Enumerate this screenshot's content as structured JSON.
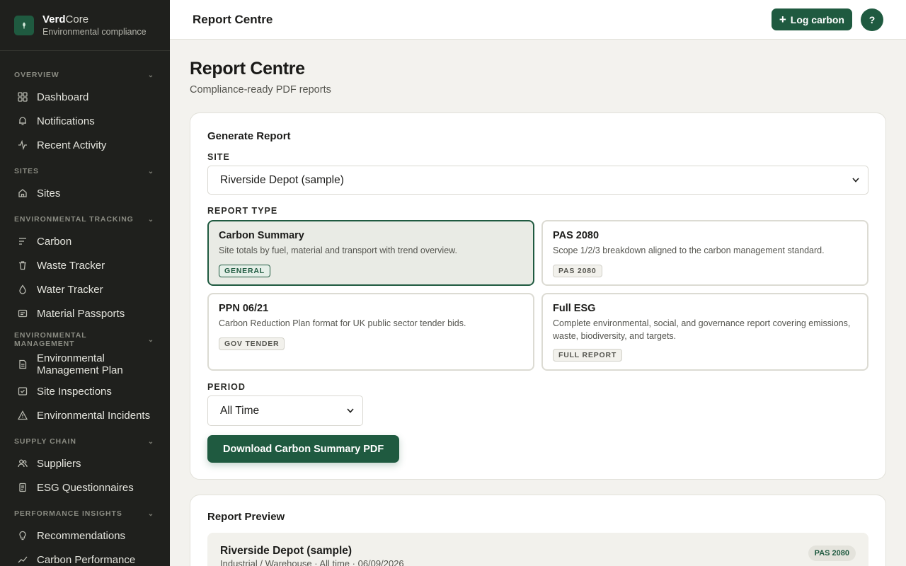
{
  "brand": {
    "name_bold": "Verd",
    "name_rest": "Core",
    "subtitle": "Environmental compliance",
    "logo_icon": "leaf-icon"
  },
  "sidebar": {
    "sections": [
      {
        "title": "OVERVIEW",
        "items": [
          {
            "label": "Dashboard",
            "icon": "grid-icon"
          },
          {
            "label": "Notifications",
            "icon": "bell-icon"
          },
          {
            "label": "Recent Activity",
            "icon": "activity-icon"
          }
        ]
      },
      {
        "title": "SITES",
        "items": [
          {
            "label": "Sites",
            "icon": "home-icon"
          }
        ]
      },
      {
        "title": "ENVIRONMENTAL TRACKING",
        "items": [
          {
            "label": "Carbon",
            "icon": "lines-icon"
          },
          {
            "label": "Waste Tracker",
            "icon": "bin-icon"
          },
          {
            "label": "Water Tracker",
            "icon": "droplet-icon"
          },
          {
            "label": "Material Passports",
            "icon": "id-card-icon"
          }
        ]
      },
      {
        "title": "ENVIRONMENTAL MANAGEMENT",
        "items": [
          {
            "label": "Environmental Management Plan",
            "icon": "document-icon"
          },
          {
            "label": "Site Inspections",
            "icon": "check-square-icon"
          },
          {
            "label": "Environmental Incidents",
            "icon": "warning-icon"
          }
        ]
      },
      {
        "title": "SUPPLY CHAIN",
        "items": [
          {
            "label": "Suppliers",
            "icon": "users-icon"
          },
          {
            "label": "ESG Questionnaires",
            "icon": "clipboard-icon"
          }
        ]
      },
      {
        "title": "PERFORMANCE INSIGHTS",
        "items": [
          {
            "label": "Recommendations",
            "icon": "lightbulb-icon"
          },
          {
            "label": "Carbon Performance",
            "icon": "trend-icon"
          }
        ]
      }
    ]
  },
  "topbar": {
    "title": "Report Centre",
    "log_label": "Log carbon",
    "help_label": "?"
  },
  "page": {
    "title": "Report Centre",
    "subtitle": "Compliance-ready PDF reports"
  },
  "generate": {
    "title": "Generate Report",
    "site_label": "SITE",
    "site_value": "Riverside Depot (sample)",
    "type_label": "REPORT TYPE",
    "types": [
      {
        "name": "Carbon Summary",
        "desc": "Site totals by fuel, material and transport with trend overview.",
        "badge": "GENERAL",
        "selected": true
      },
      {
        "name": "PAS 2080",
        "desc": "Scope 1/2/3 breakdown aligned to the carbon management standard.",
        "badge": "PAS 2080",
        "selected": false
      },
      {
        "name": "PPN 06/21",
        "desc": "Carbon Reduction Plan format for UK public sector tender bids.",
        "badge": "GOV TENDER",
        "selected": false
      },
      {
        "name": "Full ESG",
        "desc": "Complete environmental, social, and governance report covering emissions, waste, biodiversity, and targets.",
        "badge": "FULL REPORT",
        "selected": false
      }
    ],
    "period_label": "PERIOD",
    "period_value": "All Time",
    "download_label": "Download Carbon Summary PDF"
  },
  "preview": {
    "title": "Report Preview",
    "site": "Riverside Depot (sample)",
    "meta": "Industrial / Warehouse · All time · 06/09/2026",
    "badge": "PAS 2080"
  },
  "colors": {
    "accent": "#1f5a40",
    "sidebar_bg": "#1f201d",
    "page_bg": "#f3f2ee"
  }
}
